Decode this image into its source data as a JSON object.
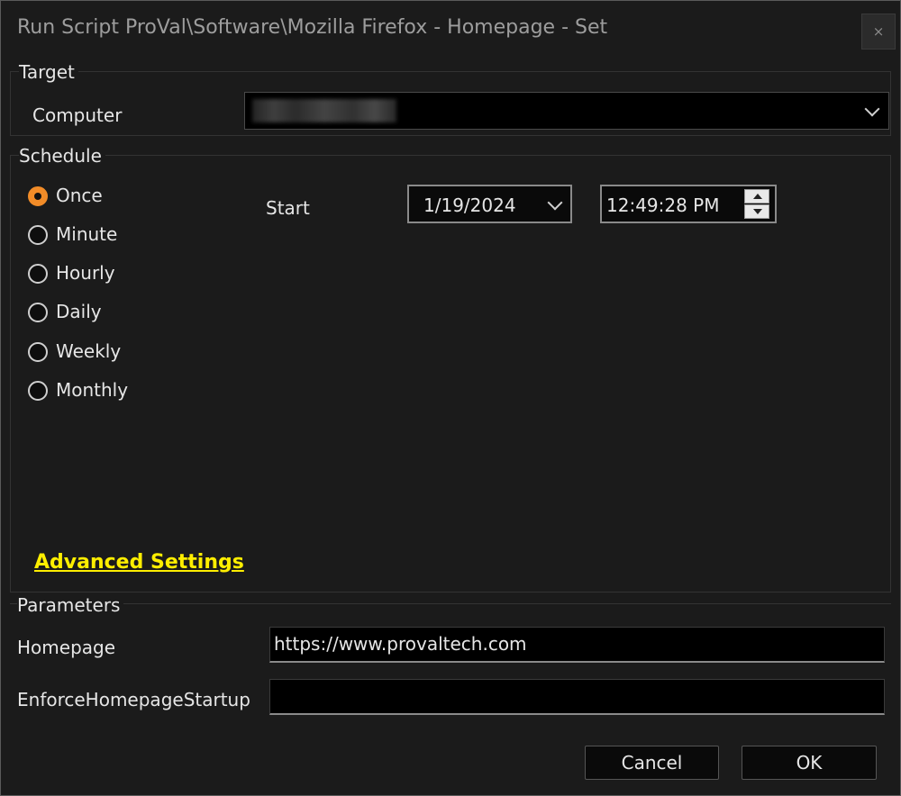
{
  "window": {
    "title": "Run Script ProVal\\Software\\Mozilla Firefox - Homepage - Set",
    "close_icon": "×"
  },
  "target": {
    "group_title": "Target",
    "computer_label": "Computer",
    "computer_value": ""
  },
  "schedule": {
    "group_title": "Schedule",
    "options": [
      {
        "label": "Once",
        "checked": true
      },
      {
        "label": "Minute",
        "checked": false
      },
      {
        "label": "Hourly",
        "checked": false
      },
      {
        "label": "Daily",
        "checked": false
      },
      {
        "label": "Weekly",
        "checked": false
      },
      {
        "label": "Monthly",
        "checked": false
      }
    ],
    "start_label": "Start",
    "start_date": "1/19/2024",
    "start_time": "12:49:28 PM",
    "advanced_link": "Advanced Settings"
  },
  "parameters": {
    "group_title": "Parameters",
    "homepage_label": "Homepage",
    "homepage_value": "https://www.provaltech.com",
    "enforce_label": "EnforceHomepageStartup",
    "enforce_value": ""
  },
  "buttons": {
    "cancel": "Cancel",
    "ok": "OK"
  },
  "colors": {
    "background": "#1b1b1b",
    "radio_accent": "#f28c28",
    "link": "#ffee00"
  }
}
